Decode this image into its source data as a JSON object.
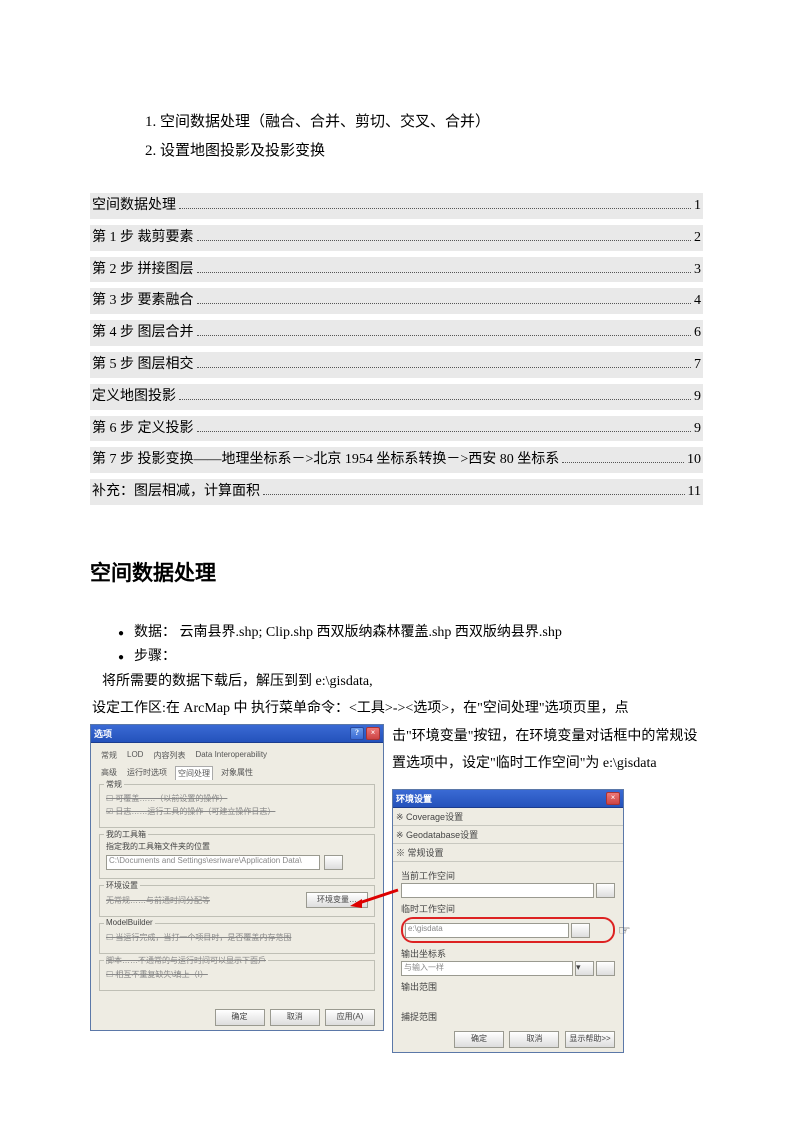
{
  "top_list": {
    "item1_num": "1.",
    "item1": "空间数据处理（融合、合并、剪切、交叉、合并）",
    "item2_num": "2.",
    "item2": "设置地图投影及投影变换"
  },
  "toc": [
    {
      "label": "空间数据处理",
      "page": "1"
    },
    {
      "label": "第 1 步 裁剪要素",
      "page": "2"
    },
    {
      "label": "第 2 步 拼接图层",
      "page": "3"
    },
    {
      "label": "第 3 步 要素融合",
      "page": "4"
    },
    {
      "label": "第 4 步 图层合并",
      "page": "6"
    },
    {
      "label": "第 5 步 图层相交",
      "page": "7"
    },
    {
      "label": "定义地图投影",
      "page": "9"
    },
    {
      "label": "第 6 步 定义投影",
      "page": "9"
    },
    {
      "label": "第 7 步 投影变换——地理坐标系－>北京 1954 坐标系转换－>西安 80 坐标系",
      "page": "10"
    },
    {
      "label": "补充：图层相减，计算面积",
      "page": "11"
    }
  ],
  "section_title": "空间数据处理",
  "bullets": {
    "b1_label": "数据：",
    "b1_text": "云南县界.shp; Clip.shp 西双版纳森林覆盖.shp 西双版纳县界.shp",
    "b2_label": "步骤："
  },
  "paras": {
    "p1": "将所需要的数据下载后，解压到到 e:\\gisdata,",
    "p2": "设定工作区:在 ArcMap 中 执行菜单命令：<工具>-><选项>，在\"空间处理\"选项页里，点",
    "right1": "击\"环境变量\"按钮，在环境变量对话框中的常规设置选项中，设定\"临时工作空间\"为 e:\\gisdata"
  },
  "dialog1": {
    "title": "选项",
    "tabs_top": [
      "常规",
      "LOD",
      "内容列表",
      "Data Interoperability"
    ],
    "tabs_bot": [
      "高级",
      "运行时选项",
      "空间处理",
      "对象属性"
    ],
    "group_general": "常规",
    "chk_overwrite": "可覆盖……（以前设置的操作）",
    "chk_log": "日志……运行工具的操作（可建立操作日志）",
    "group_toolbox": "我的工具箱",
    "toolbox_label": "指定我的工具箱文件夹的位置",
    "toolbox_value": "C:\\Documents and Settings\\esriware\\Application Data\\",
    "group_env": "环境设置",
    "env_text": "无常规……与前通时间分配等",
    "env_button": "环境变量…",
    "group_mg": "ModelBuilder",
    "mg_chk": "当运行完成，当打一个项目时，是否覆盖内存范围",
    "group_script": "脚本……不通常的与运行时间可以显示下面戶",
    "script_chk": "相互不重复缺失\\填上（I）",
    "btn_ok": "确定",
    "btn_cancel": "取消",
    "btn_apply": "应用(A)"
  },
  "dialog2": {
    "title": "环境设置",
    "acc1": "※ Coverage设置",
    "acc2": "※ Geodatabase设置",
    "acc3": "※ 常规设置",
    "lbl_current": "当前工作空间",
    "lbl_temp": "临时工作空间",
    "temp_value": "e:\\gisdata",
    "lbl_coord": "输出坐标系",
    "coord_value": "与输入一样",
    "lbl_extent": "输出范围",
    "lbl_snap": "捕捉范围",
    "btn_ok": "确定",
    "btn_cancel": "取消",
    "btn_help": "显示帮助>>"
  }
}
